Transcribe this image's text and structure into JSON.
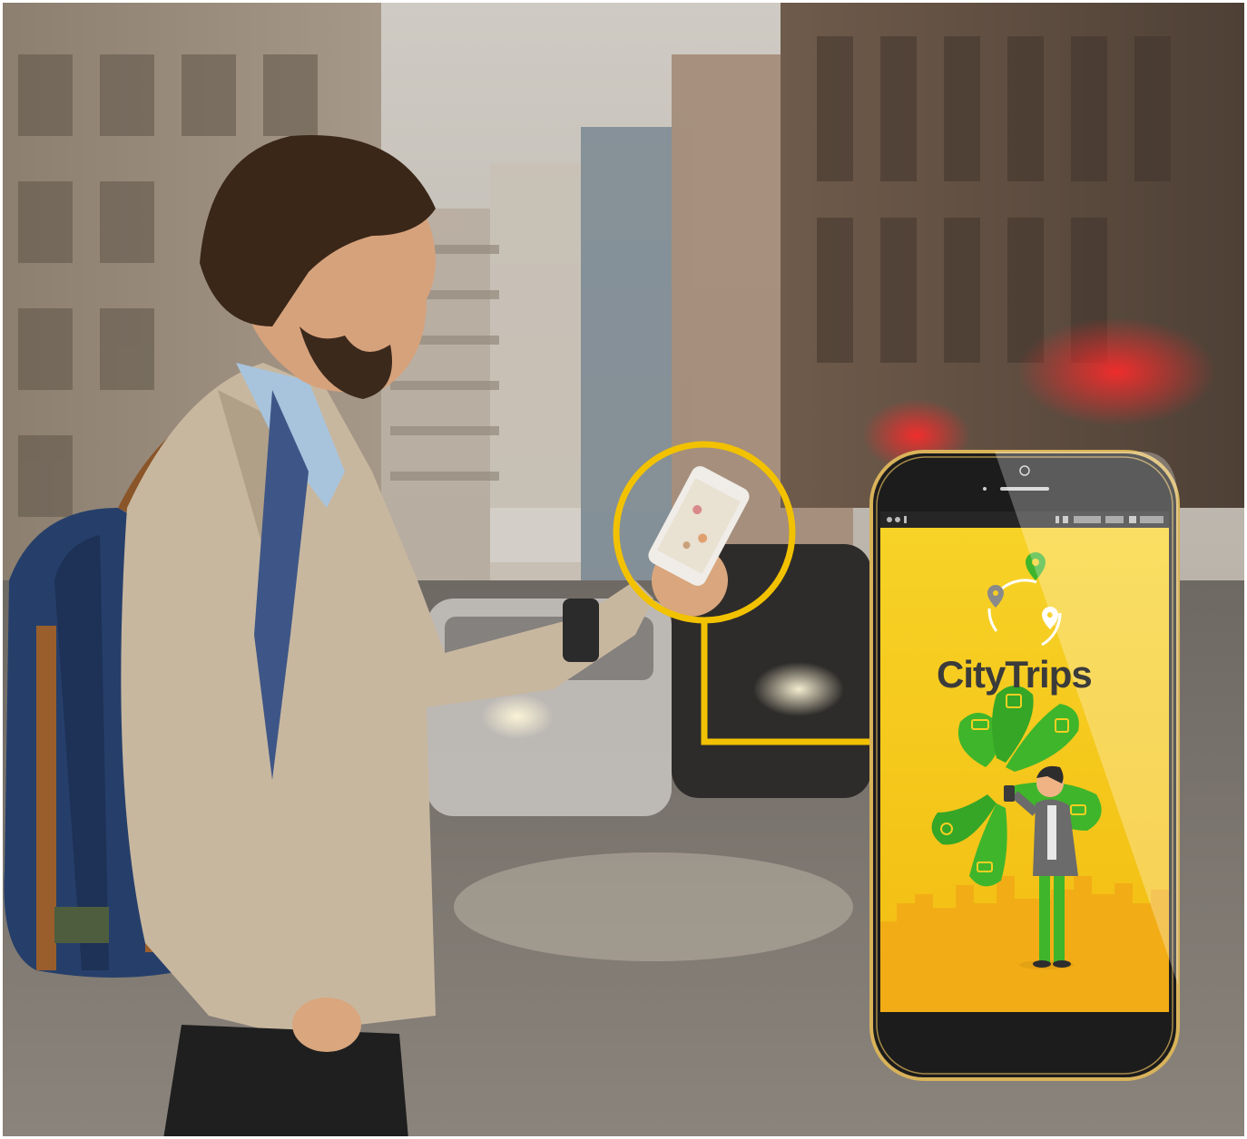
{
  "app": {
    "name": "CityTrips"
  },
  "colors": {
    "accent_yellow": "#f2c200",
    "screen_yellow": "#f5cc1a",
    "phone_frame_gold": "#d9b35a",
    "phone_body_dark": "#1c1c1c",
    "icon_green": "#3fb52b"
  },
  "icons": [
    "location-pin-icon",
    "refresh-cycle-icon",
    "taxi-icon",
    "bus-icon",
    "train-icon",
    "car-icon",
    "bike-icon"
  ]
}
